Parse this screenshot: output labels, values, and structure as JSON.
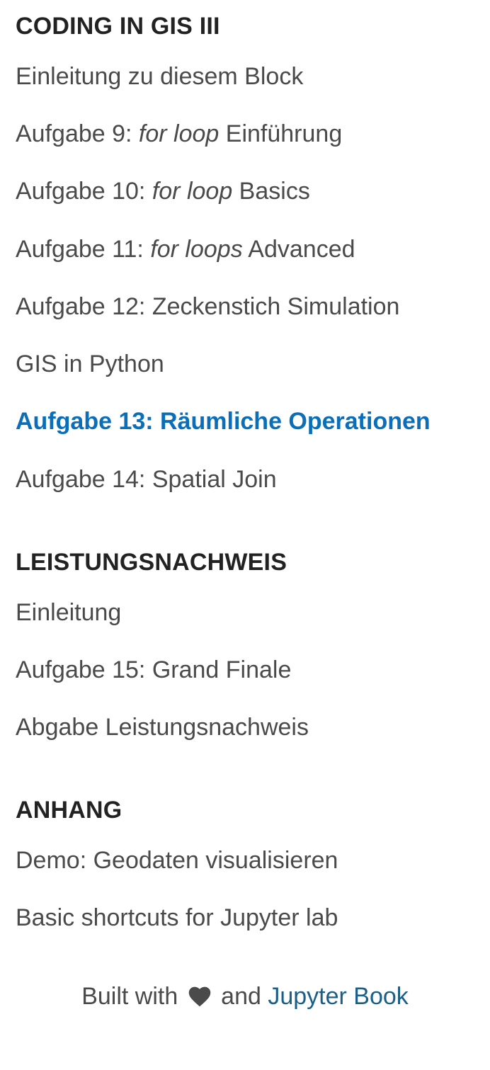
{
  "sections": [
    {
      "caption": "CODING IN GIS III",
      "items": [
        {
          "label": "Einleitung zu diesem Block"
        },
        {
          "prefix": "Aufgabe 9: ",
          "em": "for loop",
          "suffix": " Einführung"
        },
        {
          "prefix": "Aufgabe 10: ",
          "em": "for loop",
          "suffix": " Basics"
        },
        {
          "prefix": "Aufgabe 11: ",
          "em": "for loops",
          "suffix": " Advanced"
        },
        {
          "label": "Aufgabe 12: Zeckenstich Simulation"
        },
        {
          "label": "GIS in Python"
        },
        {
          "label": "Aufgabe 13: Räumliche Operationen",
          "active": true
        },
        {
          "label": "Aufgabe 14: Spatial Join"
        }
      ]
    },
    {
      "caption": "LEISTUNGSNACHWEIS",
      "items": [
        {
          "label": "Einleitung"
        },
        {
          "label": "Aufgabe 15: Grand Finale"
        },
        {
          "label": "Abgabe Leistungsnachweis"
        }
      ]
    },
    {
      "caption": "ANHANG",
      "items": [
        {
          "label": "Demo: Geodaten visualisieren"
        },
        {
          "label": "Basic shortcuts for Jupyter lab"
        }
      ]
    }
  ],
  "footer": {
    "prefix": "Built with",
    "heart_icon": "heart-icon",
    "middle": "and",
    "link_label": "Jupyter Book"
  },
  "colors": {
    "active": "#0a6fb8",
    "link": "#1a5f88",
    "text": "#4a4a4a",
    "caption": "#222222"
  }
}
